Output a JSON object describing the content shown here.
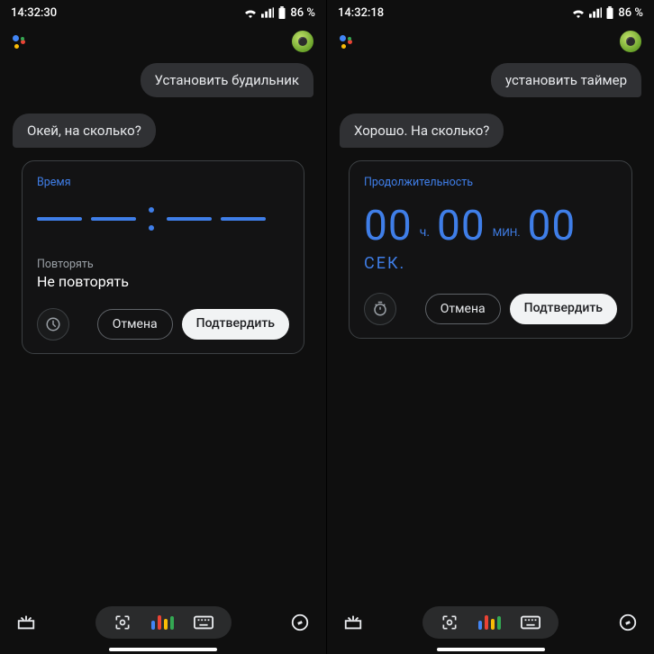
{
  "colors": {
    "accent": "#3f7ee8"
  },
  "left": {
    "status": {
      "time": "14:32:30",
      "battery": "86 %"
    },
    "user_query": "Установить будильник",
    "assistant_reply": "Окей, на сколько?",
    "card": {
      "label": "Время",
      "repeat_label": "Повторять",
      "repeat_value": "Не повторять",
      "cancel": "Отмена",
      "confirm": "Подтвердить"
    }
  },
  "right": {
    "status": {
      "time": "14:32:18",
      "battery": "86 %"
    },
    "user_query": "установить таймер",
    "assistant_reply": "Хорошо. На сколько?",
    "card": {
      "label": "Продолжительность",
      "hours": "00",
      "hours_unit": "ч.",
      "minutes": "00",
      "minutes_unit": "МИН.",
      "seconds": "00",
      "seconds_unit": "СЕК.",
      "cancel": "Отмена",
      "confirm": "Подтвердить"
    }
  }
}
